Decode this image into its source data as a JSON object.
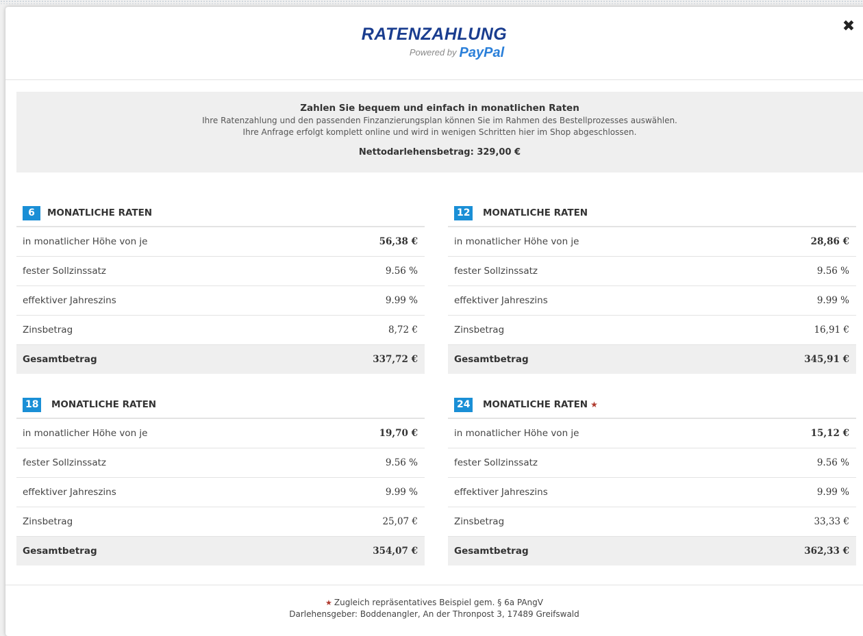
{
  "header": {
    "logo_title": "RATENZAHLUNG",
    "logo_powered": "Powered by",
    "logo_brand": "PayPal",
    "close_icon": "close-icon"
  },
  "intro": {
    "title": "Zahlen Sie bequem und einfach in monatlichen Raten",
    "line1": "Ihre Ratenzahlung und den passenden Finzanzierungsplan können Sie im Rahmen des Bestellprozesses auswählen.",
    "line2": "Ihre Anfrage erfolgt komplett online und wird in wenigen Schritten hier im Shop abgeschlossen.",
    "amount": "Nettodarlehensbetrag: 329,00 €"
  },
  "labels": {
    "rate": "in monatlicher Höhe von je",
    "sollzins": "fester Sollzinssatz",
    "effzins": "effektiver Jahreszins",
    "zinsbetrag": "Zinsbetrag",
    "gesamt": "Gesamtbetrag",
    "heading": "MONATLICHE RATEN"
  },
  "plans": [
    {
      "months": "6",
      "rate": "56,38 €",
      "sollzins": "9.56 %",
      "effzins": "9.99 %",
      "zinsbetrag": "8,72 €",
      "gesamt": "337,72 €"
    },
    {
      "months": "12",
      "rate": "28,86 €",
      "sollzins": "9.56 %",
      "effzins": "9.99 %",
      "zinsbetrag": "16,91 €",
      "gesamt": "345,91 €"
    },
    {
      "months": "18",
      "rate": "19,70 €",
      "sollzins": "9.56 %",
      "effzins": "9.99 %",
      "zinsbetrag": "25,07 €",
      "gesamt": "354,07 €"
    },
    {
      "months": "24",
      "rate": "15,12 €",
      "sollzins": "9.56 %",
      "effzins": "9.99 %",
      "zinsbetrag": "33,33 €",
      "gesamt": "362,33 €",
      "representative": true
    }
  ],
  "footer": {
    "star": "★",
    "note": "Zugleich repräsentatives Beispiel gem. § 6a PAngV",
    "lender": "Darlehensgeber: Boddenangler, An der Thronpost 3, 17489 Greifswald"
  },
  "colors": {
    "brand_dark": "#1a3d8f",
    "brand_light": "#2a7fd9",
    "badge": "#1a8fd6",
    "star": "#b03a2e"
  }
}
